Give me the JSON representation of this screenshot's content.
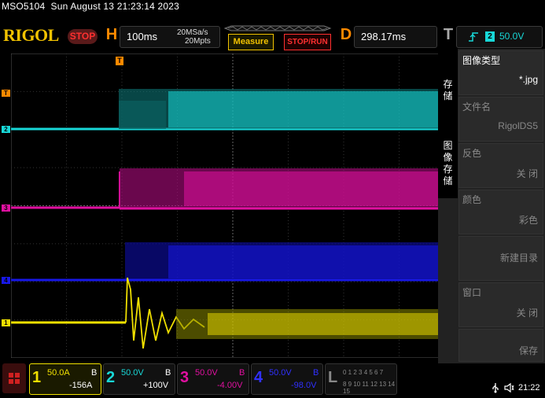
{
  "header": {
    "model": "MSO5104",
    "datetime": "Sun August 13 21:23:14 2023",
    "logo": "RIGOL",
    "run_state": "STOP",
    "horizontal": {
      "letter": "H",
      "timebase": "100ms",
      "sample_rate": "20MSa/s",
      "memory_depth": "20Mpts"
    },
    "measure_label": "Measure",
    "stop_run_label": "STOP/RUN",
    "delay": {
      "letter": "D",
      "value": "298.17ms"
    },
    "trigger": {
      "letter": "T",
      "channel": "2",
      "level": "50.0V"
    }
  },
  "waveform_markers": {
    "trigger_marker": "T",
    "channel_markers": [
      "1",
      "2",
      "3",
      "4"
    ],
    "colors": {
      "ch1": "#f0e000",
      "ch2": "#18d8d8",
      "ch3": "#e010a0",
      "ch4": "#1818e8"
    }
  },
  "side_menu": {
    "section1": "存储",
    "section2": "图像存储",
    "items": [
      {
        "label": "图像类型",
        "value": "*.jpg",
        "active": true
      },
      {
        "label": "文件名",
        "value": "RigolDS5",
        "active": false
      },
      {
        "label": "反色",
        "value": "关 闭",
        "active": false
      },
      {
        "label": "颜色",
        "value": "彩色",
        "active": false
      },
      {
        "label": "",
        "value": "新建目录",
        "active": false
      },
      {
        "label": "窗口",
        "value": "关 闭",
        "active": false
      },
      {
        "label": "",
        "value": "保存",
        "active": false
      }
    ]
  },
  "channels": [
    {
      "num": "1",
      "scale": "50.0A",
      "bw": "B",
      "offset": "-156A",
      "color": "#f0e000"
    },
    {
      "num": "2",
      "scale": "50.0V",
      "bw": "B",
      "offset": "+100V",
      "color": "#18d8d8"
    },
    {
      "num": "3",
      "scale": "50.0V",
      "bw": "B",
      "offset": "-4.00V",
      "color": "#e010a0"
    },
    {
      "num": "4",
      "scale": "50.0V",
      "bw": "B",
      "offset": "-98.0V",
      "color": "#3030ff"
    }
  ],
  "logic": {
    "letter": "L",
    "row1": "0 1 2 3 4 5 6 7",
    "row2": "8 9 10 11 12 13 14 15"
  },
  "tray": {
    "time": "21:22"
  }
}
